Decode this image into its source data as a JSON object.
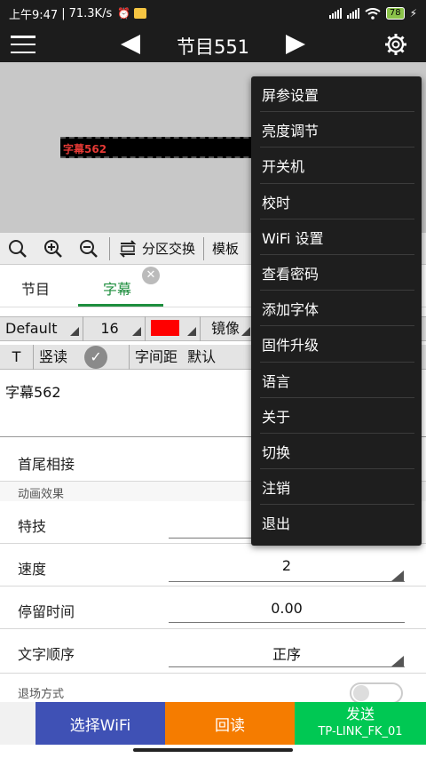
{
  "status_bar": {
    "time": "上午9:47",
    "speed": "71.3K/s",
    "battery": "78",
    "icons": [
      "alarm-icon",
      "notification-icon",
      "signal-icon",
      "wifi-icon",
      "battery-icon",
      "charging-icon"
    ]
  },
  "header": {
    "title": "节目551"
  },
  "preview": {
    "led_text": "字幕562",
    "led_text_color": "#e53935"
  },
  "toolbar": {
    "partition_label": "分区交换",
    "template_label": "模板"
  },
  "tabs": [
    {
      "label": "节目"
    },
    {
      "label": "字幕"
    }
  ],
  "font_row": {
    "font": "Default",
    "size": "16",
    "color": "#ff0000",
    "mirror_label": "镜像"
  },
  "style_row": {
    "t_label": "T",
    "vertical_label": "竖读",
    "spacing_label": "字间距",
    "spacing_value": "默认"
  },
  "text_input": {
    "value": "字幕562"
  },
  "settings": {
    "head_tail_label": "首尾相接",
    "animation_section": "动画效果",
    "effect_label": "特技",
    "speed_label": "速度",
    "speed_value": "2",
    "stay_label": "停留时间",
    "stay_value": "0.00",
    "order_label": "文字顺序",
    "order_value": "正序",
    "exit_label": "退场方式"
  },
  "bottom_bar": {
    "wifi_label": "选择WiFi",
    "read_label": "回读",
    "send_label": "发送",
    "ssid": "TP-LINK_FK_01"
  },
  "menu": {
    "items": [
      "屏参设置",
      "亮度调节",
      "开关机",
      "校时",
      "WiFi 设置",
      "查看密码",
      "添加字体",
      "固件升级",
      "语言",
      "关于",
      "切换",
      "注销",
      "退出"
    ]
  },
  "colors": {
    "accent_green": "#1e8e3e",
    "wifi_button": "#3f51b5",
    "read_button": "#f57c00",
    "send_button": "#00c853"
  }
}
